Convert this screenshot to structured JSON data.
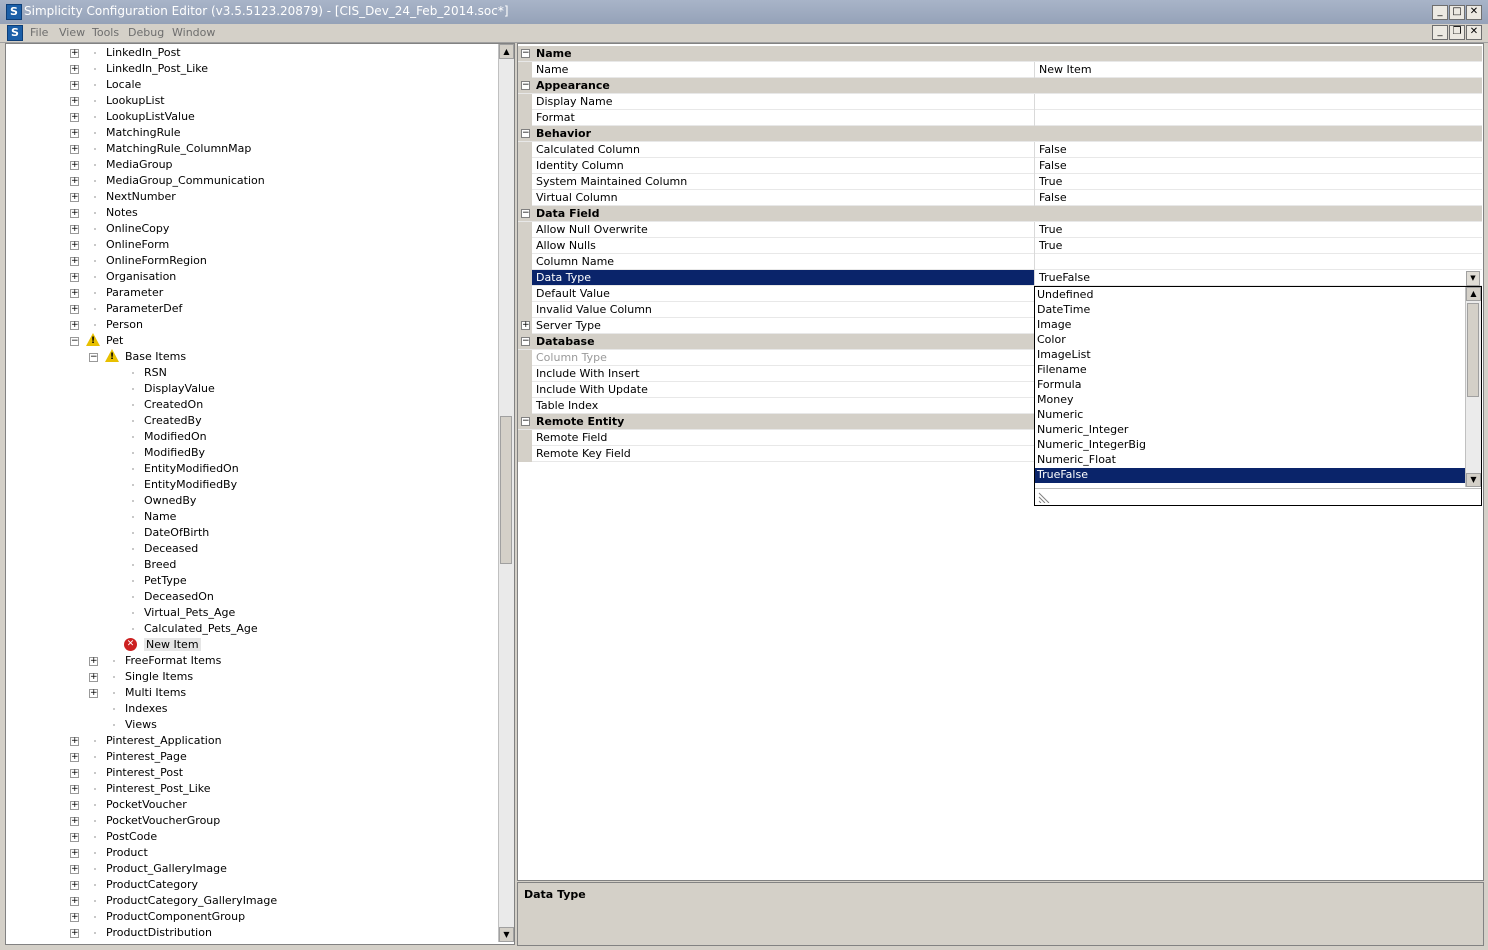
{
  "window": {
    "title": "Simplicity Configuration Editor (v3.5.5123.20879) - [CIS_Dev_24_Feb_2014.soc*]",
    "app_icon": "S",
    "controls": {
      "minimize": "_",
      "maximize": "□",
      "close": "✕",
      "restore": "❐"
    }
  },
  "menu": [
    "File",
    "View",
    "Tools",
    "Debug",
    "Window"
  ],
  "tree": {
    "items": [
      {
        "label": "LinkedIn_Post",
        "level": 0,
        "expander": "+"
      },
      {
        "label": "LinkedIn_Post_Like",
        "level": 0,
        "expander": "+"
      },
      {
        "label": "Locale",
        "level": 0,
        "expander": "+"
      },
      {
        "label": "LookupList",
        "level": 0,
        "expander": "+"
      },
      {
        "label": "LookupListValue",
        "level": 0,
        "expander": "+"
      },
      {
        "label": "MatchingRule",
        "level": 0,
        "expander": "+"
      },
      {
        "label": "MatchingRule_ColumnMap",
        "level": 0,
        "expander": "+"
      },
      {
        "label": "MediaGroup",
        "level": 0,
        "expander": "+"
      },
      {
        "label": "MediaGroup_Communication",
        "level": 0,
        "expander": "+"
      },
      {
        "label": "NextNumber",
        "level": 0,
        "expander": "+"
      },
      {
        "label": "Notes",
        "level": 0,
        "expander": "+"
      },
      {
        "label": "OnlineCopy",
        "level": 0,
        "expander": "+"
      },
      {
        "label": "OnlineForm",
        "level": 0,
        "expander": "+"
      },
      {
        "label": "OnlineFormRegion",
        "level": 0,
        "expander": "+"
      },
      {
        "label": "Organisation",
        "level": 0,
        "expander": "+"
      },
      {
        "label": "Parameter",
        "level": 0,
        "expander": "+"
      },
      {
        "label": "ParameterDef",
        "level": 0,
        "expander": "+"
      },
      {
        "label": "Person",
        "level": 0,
        "expander": "+"
      },
      {
        "label": "Pet",
        "level": 0,
        "expander": "−",
        "icon": "warning"
      },
      {
        "label": "Base Items",
        "level": 1,
        "expander": "−",
        "icon": "warning"
      },
      {
        "label": "RSN",
        "level": 2
      },
      {
        "label": "DisplayValue",
        "level": 2
      },
      {
        "label": "CreatedOn",
        "level": 2
      },
      {
        "label": "CreatedBy",
        "level": 2
      },
      {
        "label": "ModifiedOn",
        "level": 2
      },
      {
        "label": "ModifiedBy",
        "level": 2
      },
      {
        "label": "EntityModifiedOn",
        "level": 2
      },
      {
        "label": "EntityModifiedBy",
        "level": 2
      },
      {
        "label": "OwnedBy",
        "level": 2
      },
      {
        "label": "Name",
        "level": 2
      },
      {
        "label": "DateOfBirth",
        "level": 2
      },
      {
        "label": "Deceased",
        "level": 2
      },
      {
        "label": "Breed",
        "level": 2
      },
      {
        "label": "PetType",
        "level": 2
      },
      {
        "label": "DeceasedOn",
        "level": 2
      },
      {
        "label": "Virtual_Pets_Age",
        "level": 2
      },
      {
        "label": "Calculated_Pets_Age",
        "level": 2
      },
      {
        "label": "New Item",
        "level": 2,
        "icon": "error",
        "selected": true
      },
      {
        "label": "FreeFormat Items",
        "level": 1,
        "expander": "+"
      },
      {
        "label": "Single Items",
        "level": 1,
        "expander": "+"
      },
      {
        "label": "Multi Items",
        "level": 1,
        "expander": "+"
      },
      {
        "label": "Indexes",
        "level": 1
      },
      {
        "label": "Views",
        "level": 1
      },
      {
        "label": "Pinterest_Application",
        "level": 0,
        "expander": "+"
      },
      {
        "label": "Pinterest_Page",
        "level": 0,
        "expander": "+"
      },
      {
        "label": "Pinterest_Post",
        "level": 0,
        "expander": "+"
      },
      {
        "label": "Pinterest_Post_Like",
        "level": 0,
        "expander": "+"
      },
      {
        "label": "PocketVoucher",
        "level": 0,
        "expander": "+"
      },
      {
        "label": "PocketVoucherGroup",
        "level": 0,
        "expander": "+"
      },
      {
        "label": "PostCode",
        "level": 0,
        "expander": "+"
      },
      {
        "label": "Product",
        "level": 0,
        "expander": "+"
      },
      {
        "label": "Product_GalleryImage",
        "level": 0,
        "expander": "+"
      },
      {
        "label": "ProductCategory",
        "level": 0,
        "expander": "+"
      },
      {
        "label": "ProductCategory_GalleryImage",
        "level": 0,
        "expander": "+"
      },
      {
        "label": "ProductComponentGroup",
        "level": 0,
        "expander": "+"
      },
      {
        "label": "ProductDistribution",
        "level": 0,
        "expander": "+"
      }
    ]
  },
  "properties": {
    "rows": [
      {
        "type": "category",
        "label": "Name"
      },
      {
        "type": "prop",
        "name": "Name",
        "value": "New Item"
      },
      {
        "type": "category",
        "label": "Appearance"
      },
      {
        "type": "prop",
        "name": "Display Name",
        "value": ""
      },
      {
        "type": "prop",
        "name": "Format",
        "value": ""
      },
      {
        "type": "category",
        "label": "Behavior"
      },
      {
        "type": "prop",
        "name": "Calculated Column",
        "value": "False"
      },
      {
        "type": "prop",
        "name": "Identity Column",
        "value": "False"
      },
      {
        "type": "prop",
        "name": "System Maintained Column",
        "value": "True"
      },
      {
        "type": "prop",
        "name": "Virtual Column",
        "value": "False"
      },
      {
        "type": "category",
        "label": "Data Field"
      },
      {
        "type": "prop",
        "name": "Allow Null Overwrite",
        "value": "True"
      },
      {
        "type": "prop",
        "name": "Allow Nulls",
        "value": "True"
      },
      {
        "type": "prop",
        "name": "Column Name",
        "value": ""
      },
      {
        "type": "prop",
        "name": "Data Type",
        "value": "TrueFalse",
        "selected": true,
        "dropdown": true
      },
      {
        "type": "prop",
        "name": "Default Value",
        "value": ""
      },
      {
        "type": "prop",
        "name": "Invalid Value Column",
        "value": ""
      },
      {
        "type": "prop",
        "name": "Server Type",
        "value": "",
        "expander": "+"
      },
      {
        "type": "category",
        "label": "Database"
      },
      {
        "type": "prop",
        "name": "Column Type",
        "value": "",
        "disabled": true
      },
      {
        "type": "prop",
        "name": "Include With Insert",
        "value": ""
      },
      {
        "type": "prop",
        "name": "Include With Update",
        "value": ""
      },
      {
        "type": "prop",
        "name": "Table Index",
        "value": ""
      },
      {
        "type": "category",
        "label": "Remote Entity"
      },
      {
        "type": "prop",
        "name": "Remote Field",
        "value": ""
      },
      {
        "type": "prop",
        "name": "Remote Key Field",
        "value": ""
      }
    ]
  },
  "dropdown": {
    "options": [
      "Undefined",
      "DateTime",
      "Image",
      "Color",
      "ImageList",
      "Filename",
      "Formula",
      "Money",
      "Numeric",
      "Numeric_Integer",
      "Numeric_IntegerBig",
      "Numeric_Float",
      "TrueFalse"
    ],
    "selected": "TrueFalse"
  },
  "help": {
    "title": "Data Type"
  },
  "colors": {
    "selection": "#0a246a",
    "titlebar": "#9aa7bd",
    "chrome": "#d4d0c8"
  }
}
